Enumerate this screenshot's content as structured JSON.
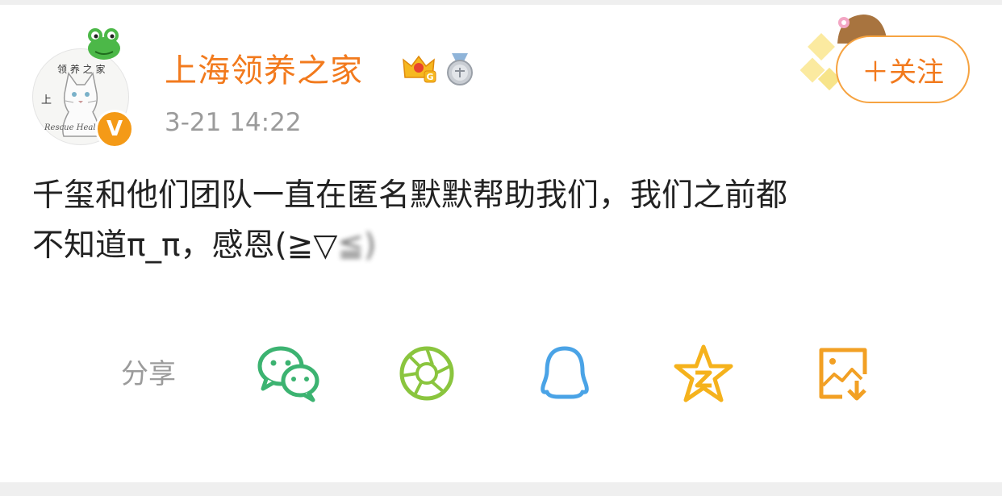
{
  "post": {
    "username": "上海领养之家",
    "timestamp": "3-21 14:22",
    "verified_badge": "V",
    "level_badge": "G",
    "follow_label": "＋关注",
    "avatar_text": {
      "top": "领 养 之 家",
      "ring": "Rescue Heal",
      "char": "上"
    },
    "content_line1": "千玺和他们团队一直在匿名默默帮助我们，我们之前都",
    "content_line2_visible": "不知道π_π，感恩(≧▽",
    "content_line2_blurred": "≦)"
  },
  "share": {
    "label": "分享",
    "icons": [
      "wechat-icon",
      "moments-icon",
      "qq-icon",
      "qzone-icon",
      "save-image-icon"
    ]
  },
  "colors": {
    "username": "#f27a1d",
    "wechat": "#3cb371",
    "moments": "#8ac53e",
    "qq": "#4aa3e6",
    "qzone": "#f5b21c",
    "save": "#f2a024",
    "muted": "#9b9b9b"
  }
}
